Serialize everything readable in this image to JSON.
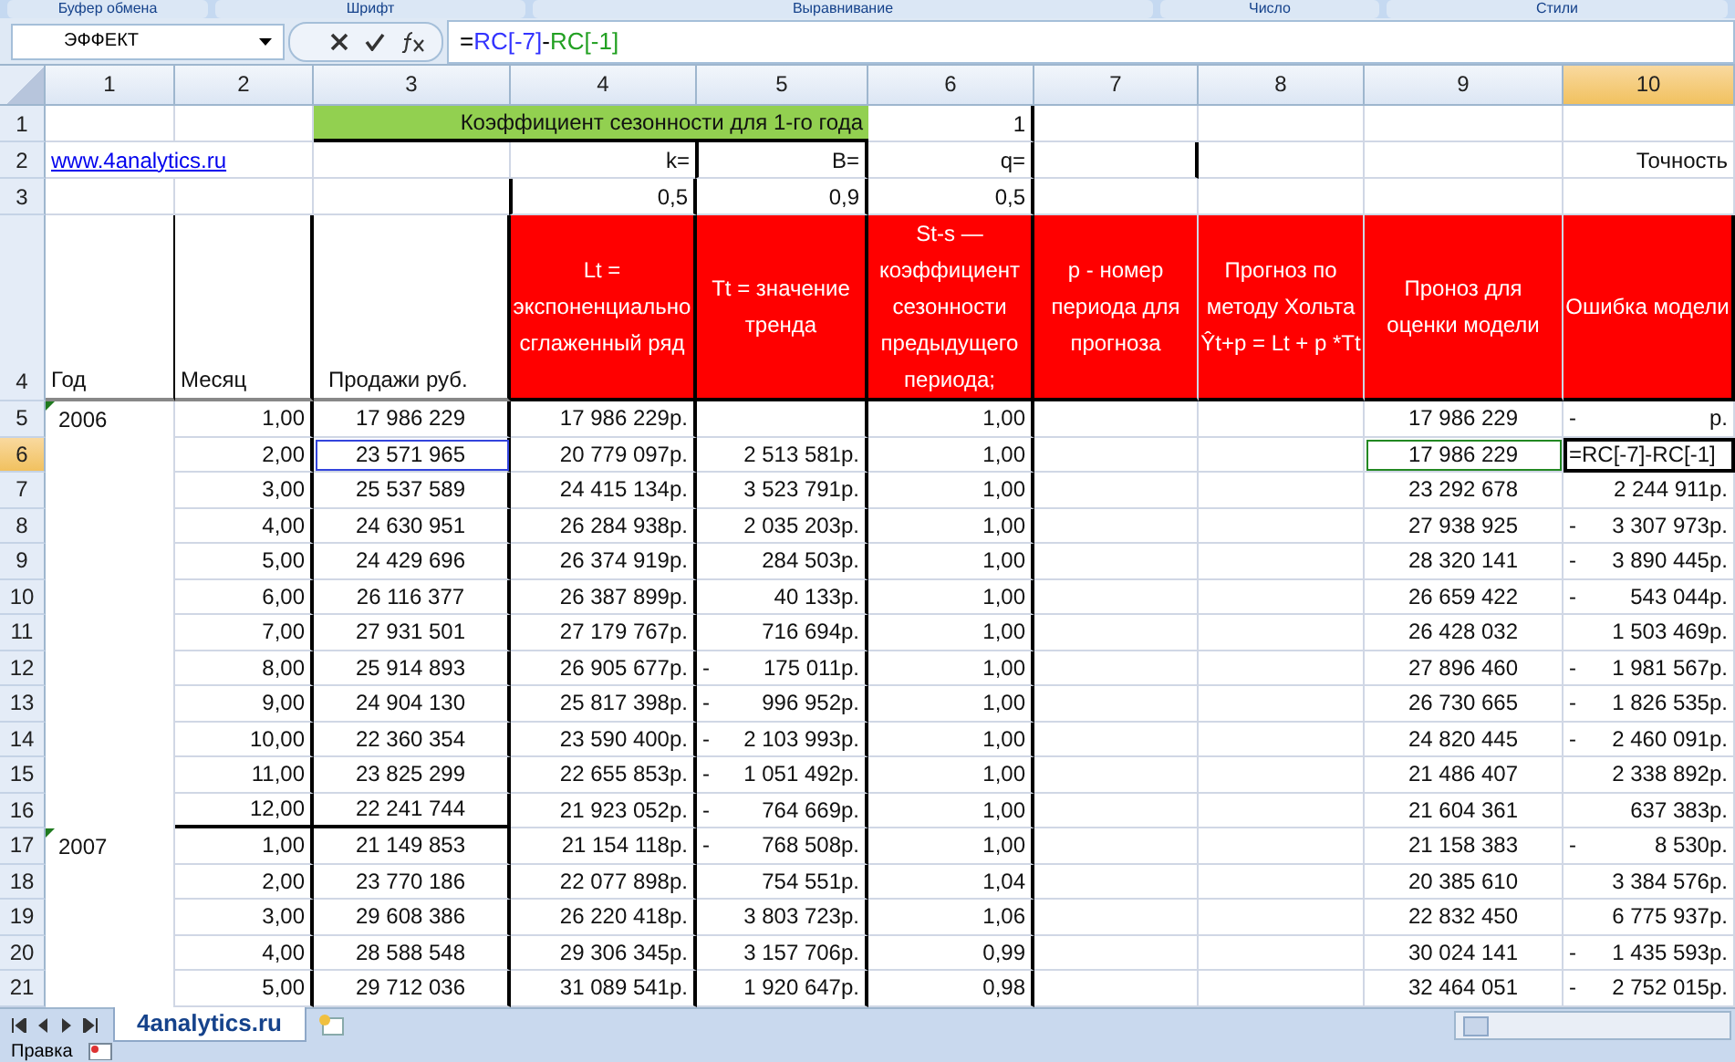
{
  "ribbon_groups": [
    "Буфер обмена",
    "Шрифт",
    "Выравнивание",
    "Число",
    "Стили"
  ],
  "name_box": "ЭФФЕКТ",
  "formula": [
    {
      "text": "=",
      "color": "#000000"
    },
    {
      "text": "RC[-7]",
      "color": "#3333ff"
    },
    {
      "text": "-",
      "color": "#000000"
    },
    {
      "text": "RC[-1]",
      "color": "#22a022"
    }
  ],
  "columns": [
    {
      "label": "1",
      "selected": false
    },
    {
      "label": "2",
      "selected": false
    },
    {
      "label": "3",
      "selected": false
    },
    {
      "label": "4",
      "selected": false
    },
    {
      "label": "5",
      "selected": false
    },
    {
      "label": "6",
      "selected": false
    },
    {
      "label": "7",
      "selected": false
    },
    {
      "label": "8",
      "selected": false
    },
    {
      "label": "9",
      "selected": false
    },
    {
      "label": "10",
      "selected": true
    }
  ],
  "top_rows": [
    {
      "number": "1",
      "selected": false,
      "cells": [
        {},
        {},
        {
          "kind": "title",
          "text": "Коэффициент сезонности для 1-го года"
        },
        {
          "kind": "param",
          "text": "1"
        },
        {},
        {},
        {},
        {}
      ]
    },
    {
      "number": "2",
      "selected": false,
      "cells": [
        {
          "kind": "link",
          "text": "www.4analytics.ru"
        },
        {},
        {
          "kind": "param",
          "text": "k="
        },
        {
          "kind": "param",
          "text": "B="
        },
        {
          "kind": "param",
          "text": "q="
        },
        {},
        {},
        {},
        {
          "kind": "plain",
          "text": "Точность"
        }
      ]
    },
    {
      "number": "3",
      "selected": false,
      "cells": [
        {},
        {},
        {},
        {
          "kind": "param",
          "text": "0,5"
        },
        {
          "kind": "param",
          "text": "0,9"
        },
        {
          "kind": "param",
          "text": "0,5"
        },
        {},
        {},
        {},
        {}
      ]
    }
  ],
  "header_row": {
    "number": "4",
    "selected": false,
    "cells": [
      {
        "kind": "plain",
        "text": "Год"
      },
      {
        "kind": "plain",
        "text": "Месяц"
      },
      {
        "kind": "plain",
        "text": "Продажи руб."
      },
      {
        "kind": "red",
        "text": "Lt = экспоненциально сглаженный ряд"
      },
      {
        "kind": "red",
        "text": "Tt = значение тренда"
      },
      {
        "kind": "red",
        "text": "St-s  — коэффициент сезонности предыдущего периода;"
      },
      {
        "kind": "red",
        "text": "p - номер периода для прогноза"
      },
      {
        "kind": "red",
        "text": "Прогноз по методу Хольта Ŷt+p = Lt + p *Tt"
      },
      {
        "kind": "red",
        "text": "Проноз для оценки модели"
      },
      {
        "kind": "red",
        "text": "Ошибка модели"
      }
    ]
  },
  "data_rows": [
    {
      "number": "5",
      "selected": false,
      "year": "2006",
      "month": "1,00",
      "sales": "17 986 229",
      "lt": "17 986 229р.",
      "st": "1,00",
      "forecast": "17 986 229",
      "error": {
        "sign": "-",
        "amount": "р."
      },
      "sales_ref": false,
      "forecast_ref": false
    },
    {
      "number": "6",
      "selected": true,
      "month": "2,00",
      "sales": "23 571 965",
      "lt": "20 779 097р.",
      "tt": {
        "amount": "2 513 581р."
      },
      "st": "1,00",
      "forecast": "17 986 229",
      "error": {
        "formula": "=RC[-7]-RC[-1]"
      },
      "sales_ref": true,
      "forecast_ref": true
    },
    {
      "number": "7",
      "selected": false,
      "month": "3,00",
      "sales": "25 537 589",
      "lt": "24 415 134р.",
      "tt": {
        "amount": "3 523 791р."
      },
      "st": "1,00",
      "forecast": "23 292 678",
      "error": {
        "amount": "2 244 911р."
      },
      "sales_ref": false,
      "forecast_ref": false
    },
    {
      "number": "8",
      "selected": false,
      "month": "4,00",
      "sales": "24 630 951",
      "lt": "26 284 938р.",
      "tt": {
        "amount": "2 035 203р."
      },
      "st": "1,00",
      "forecast": "27 938 925",
      "error": {
        "sign": "-",
        "amount": "3 307 973р."
      },
      "sales_ref": false,
      "forecast_ref": false
    },
    {
      "number": "9",
      "selected": false,
      "month": "5,00",
      "sales": "24 429 696",
      "lt": "26 374 919р.",
      "tt": {
        "amount": "284 503р."
      },
      "st": "1,00",
      "forecast": "28 320 141",
      "error": {
        "sign": "-",
        "amount": "3 890 445р."
      },
      "sales_ref": false,
      "forecast_ref": false
    },
    {
      "number": "10",
      "selected": false,
      "month": "6,00",
      "sales": "26 116 377",
      "lt": "26 387 899р.",
      "tt": {
        "amount": "40 133р."
      },
      "st": "1,00",
      "forecast": "26 659 422",
      "error": {
        "sign": "-",
        "amount": "543 044р."
      },
      "sales_ref": false,
      "forecast_ref": false
    },
    {
      "number": "11",
      "selected": false,
      "month": "7,00",
      "sales": "27 931 501",
      "lt": "27 179 767р.",
      "tt": {
        "amount": "716 694р."
      },
      "st": "1,00",
      "forecast": "26 428 032",
      "error": {
        "amount": "1 503 469р."
      },
      "sales_ref": false,
      "forecast_ref": false
    },
    {
      "number": "12",
      "selected": false,
      "month": "8,00",
      "sales": "25 914 893",
      "lt": "26 905 677р.",
      "tt": {
        "sign": "-",
        "amount": "175 011р."
      },
      "st": "1,00",
      "forecast": "27 896 460",
      "error": {
        "sign": "-",
        "amount": "1 981 567р."
      },
      "sales_ref": false,
      "forecast_ref": false
    },
    {
      "number": "13",
      "selected": false,
      "month": "9,00",
      "sales": "24 904 130",
      "lt": "25 817 398р.",
      "tt": {
        "sign": "-",
        "amount": "996 952р."
      },
      "st": "1,00",
      "forecast": "26 730 665",
      "error": {
        "sign": "-",
        "amount": "1 826 535р."
      },
      "sales_ref": false,
      "forecast_ref": false
    },
    {
      "number": "14",
      "selected": false,
      "month": "10,00",
      "sales": "22 360 354",
      "lt": "23 590 400р.",
      "tt": {
        "sign": "-",
        "amount": "2 103 993р."
      },
      "st": "1,00",
      "forecast": "24 820 445",
      "error": {
        "sign": "-",
        "amount": "2 460 091р."
      },
      "sales_ref": false,
      "forecast_ref": false
    },
    {
      "number": "15",
      "selected": false,
      "month": "11,00",
      "sales": "23 825 299",
      "lt": "22 655 853р.",
      "tt": {
        "sign": "-",
        "amount": "1 051 492р."
      },
      "st": "1,00",
      "forecast": "21 486 407",
      "error": {
        "amount": "2 338 892р."
      },
      "sales_ref": false,
      "forecast_ref": false
    },
    {
      "number": "16",
      "selected": false,
      "month": "12,00",
      "sales": "22 241 744",
      "lt": "21 923 052р.",
      "tt": {
        "sign": "-",
        "amount": "764 669р."
      },
      "st": "1,00",
      "forecast": "21 604 361",
      "error": {
        "amount": "637 383р."
      },
      "sales_ref": false,
      "forecast_ref": false
    },
    {
      "number": "17",
      "selected": false,
      "year": "2007",
      "month": "1,00",
      "sales": "21 149 853",
      "lt": "21 154 118р.",
      "tt": {
        "sign": "-",
        "amount": "768 508р."
      },
      "st": "1,00",
      "forecast": "21 158 383",
      "error": {
        "sign": "-",
        "amount": "8 530р."
      },
      "sales_ref": false,
      "forecast_ref": false
    },
    {
      "number": "18",
      "selected": false,
      "month": "2,00",
      "sales": "23 770 186",
      "lt": "22 077 898р.",
      "tt": {
        "amount": "754 551р."
      },
      "st": "1,04",
      "forecast": "20 385 610",
      "error": {
        "amount": "3 384 576р."
      },
      "sales_ref": false,
      "forecast_ref": false
    },
    {
      "number": "19",
      "selected": false,
      "month": "3,00",
      "sales": "29 608 386",
      "lt": "26 220 418р.",
      "tt": {
        "amount": "3 803 723р."
      },
      "st": "1,06",
      "forecast": "22 832 450",
      "error": {
        "amount": "6 775 937р."
      },
      "sales_ref": false,
      "forecast_ref": false
    },
    {
      "number": "20",
      "selected": false,
      "month": "4,00",
      "sales": "28 588 548",
      "lt": "29 306 345р.",
      "tt": {
        "amount": "3 157 706р."
      },
      "st": "0,99",
      "forecast": "30 024 141",
      "error": {
        "sign": "-",
        "amount": "1 435 593р."
      },
      "sales_ref": false,
      "forecast_ref": false
    },
    {
      "number": "21",
      "selected": false,
      "month": "5,00",
      "sales": "29 712 036",
      "lt": "31 089 541р.",
      "tt": {
        "amount": "1 920 647р."
      },
      "st": "0,98",
      "forecast": "32 464 051",
      "error": {
        "sign": "-",
        "amount": "2 752 015р."
      },
      "sales_ref": false,
      "forecast_ref": false
    }
  ],
  "sheet_tabs": [
    {
      "label": "4analytics.ru",
      "selected": true
    }
  ],
  "status_bar": {
    "mode": "Правка"
  }
}
